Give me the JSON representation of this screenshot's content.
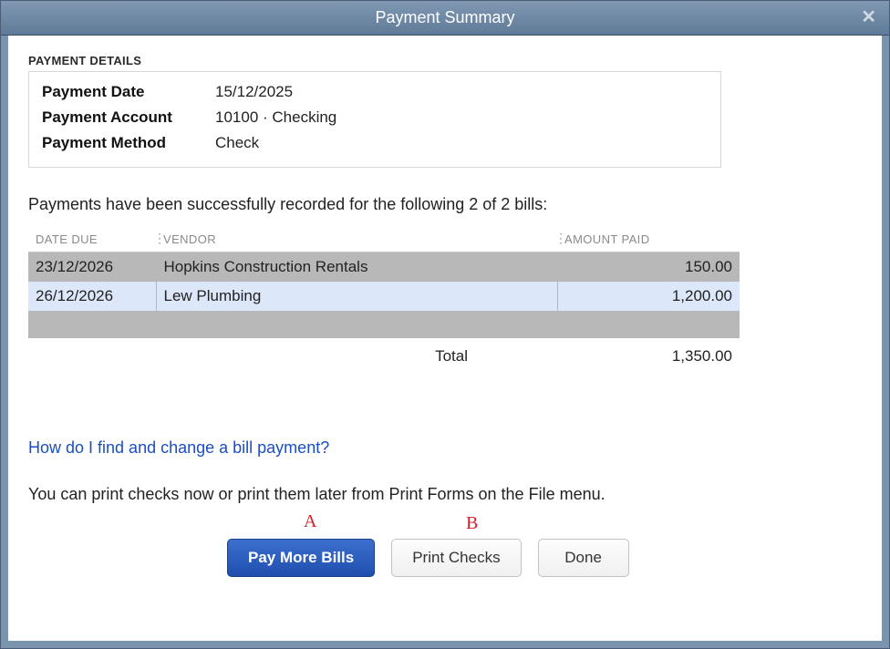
{
  "window": {
    "title": "Payment Summary"
  },
  "details": {
    "heading": "PAYMENT DETAILS",
    "rows": [
      {
        "label": "Payment Date",
        "value": "15/12/2025"
      },
      {
        "label": "Payment Account",
        "value": "10100 · Checking"
      },
      {
        "label": "Payment Method",
        "value": "Check"
      }
    ]
  },
  "message": "Payments have been successfully recorded for the following 2 of 2 bills:",
  "table": {
    "headers": {
      "date_due": "DATE DUE",
      "vendor": "VENDOR",
      "amount_paid": "AMOUNT PAID"
    },
    "rows": [
      {
        "date_due": "23/12/2026",
        "vendor": "Hopkins Construction Rentals",
        "amount_paid": "150.00"
      },
      {
        "date_due": "26/12/2026",
        "vendor": "Lew Plumbing",
        "amount_paid": "1,200.00"
      }
    ],
    "total_label": "Total",
    "total_value": "1,350.00"
  },
  "help_link": "How do I find and change a bill payment?",
  "print_note": "You can print checks now or print them later from Print Forms on the File menu.",
  "annotations": {
    "a": "A",
    "b": "B"
  },
  "buttons": {
    "pay_more": "Pay More Bills",
    "print_checks": "Print Checks",
    "done": "Done"
  }
}
